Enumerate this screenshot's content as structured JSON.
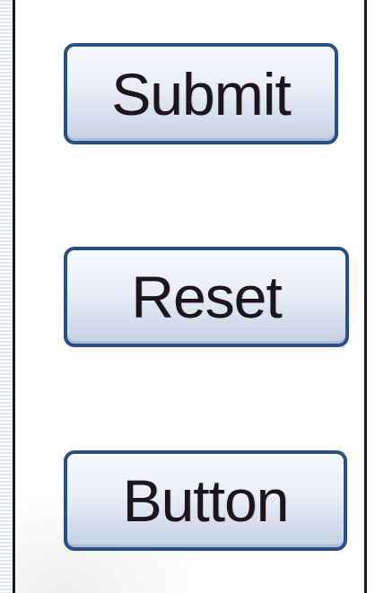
{
  "buttons": {
    "submit_label": "Submit",
    "reset_label": "Reset",
    "button_label": "Button"
  },
  "colors": {
    "button_border": "#2a4e86",
    "button_text": "#1b1520",
    "panel_border": "#1a1a1a",
    "strip": "#d7e2f2"
  }
}
